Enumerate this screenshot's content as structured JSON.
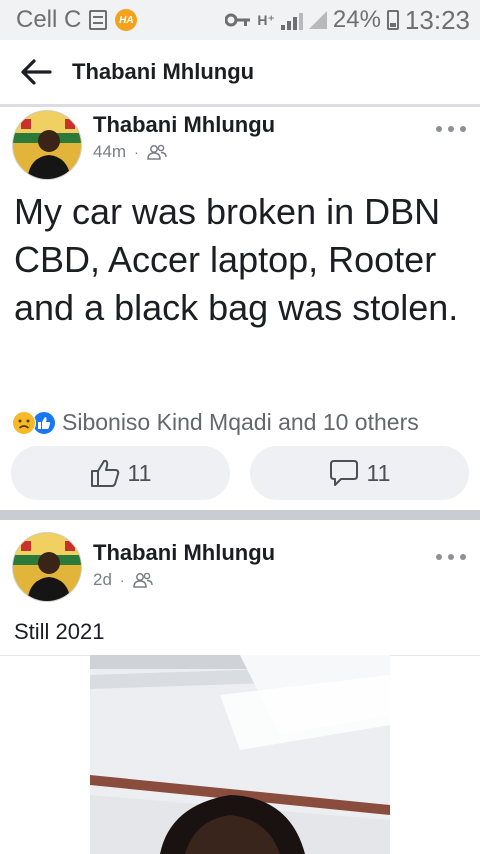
{
  "status_bar": {
    "carrier": "Cell C",
    "network_label": "H⁺",
    "battery": "24%",
    "time": "13:23",
    "icons": [
      "notes-icon",
      "ha-app-icon",
      "key-icon",
      "signal-bars-icon",
      "no-signal-icon",
      "battery-icon"
    ]
  },
  "header": {
    "title": "Thabani Mhlungu",
    "back_icon": "arrow-left-icon"
  },
  "posts": [
    {
      "author": "Thabani Mhlungu",
      "time": "44m",
      "audience_icon": "friends-icon",
      "text": "My car was broken in DBN CBD, Accer laptop, Rooter and a black bag was stolen.",
      "reactions_text": "Siboniso Kind Mqadi and 10 others",
      "reaction_icons": [
        "sad-reaction-icon",
        "like-reaction-icon"
      ],
      "like_count": "11",
      "comment_count": "11"
    },
    {
      "author": "Thabani Mhlungu",
      "time": "2d",
      "audience_icon": "friends-icon",
      "text": "Still 2021"
    }
  ],
  "colors": {
    "status_bar_bg": "#f1f2f4",
    "separator": "#c9ccd1",
    "action_bg": "#eff0f3",
    "like_blue": "#1877f2",
    "sad_yellow": "#f7b928"
  }
}
